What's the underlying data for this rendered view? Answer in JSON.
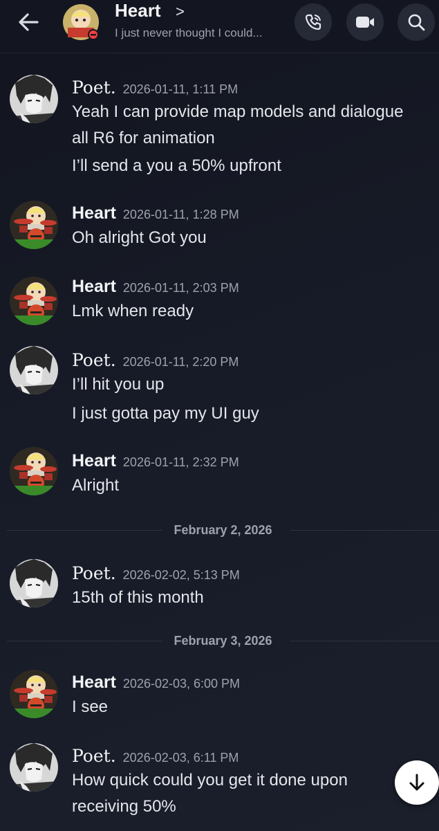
{
  "header": {
    "title": "Heart",
    "chevron": ">",
    "subtitle": "I just never thought I could..."
  },
  "messages": [
    {
      "author": "Poet.",
      "timestamp": "2026-01-11, 1:11 PM",
      "lines": [
        "Yeah I can provide map models and dialogue",
        "all R6 for animation",
        "I’ll send a you a 50% upfront"
      ]
    },
    {
      "author": "Heart",
      "timestamp": "2026-01-11, 1:28 PM",
      "lines": [
        "Oh alright Got you"
      ]
    },
    {
      "author": "Heart",
      "timestamp": "2026-01-11, 2:03 PM",
      "lines": [
        "Lmk when ready"
      ]
    },
    {
      "author": "Poet.",
      "timestamp": "2026-01-11, 2:20 PM",
      "lines": [
        "I’ll hit you up",
        "I just gotta pay my UI guy"
      ]
    },
    {
      "author": "Heart",
      "timestamp": "2026-01-11, 2:32 PM",
      "lines": [
        "Alright"
      ]
    },
    {
      "author": "Poet.",
      "timestamp": "2026-02-02, 5:13 PM",
      "lines": [
        "15th of this month"
      ]
    },
    {
      "author": "Heart",
      "timestamp": "2026-02-03, 6:00 PM",
      "lines": [
        "I see"
      ]
    },
    {
      "author": "Poet.",
      "timestamp": "2026-02-03, 6:11 PM",
      "lines": [
        "How quick could you get it done upon",
        "receiving 50%"
      ]
    }
  ],
  "dividers": [
    "February 2, 2026",
    "February 3, 2026"
  ],
  "colors": {
    "background": "#171b27",
    "accent_dnd": "#f23f43",
    "text": "#e4e6eb",
    "muted": "#9ea2ad"
  },
  "icons": {
    "back": "arrow-left-icon",
    "call": "phone-icon",
    "video": "video-camera-icon",
    "search": "search-icon",
    "scroll": "arrow-down-icon"
  }
}
